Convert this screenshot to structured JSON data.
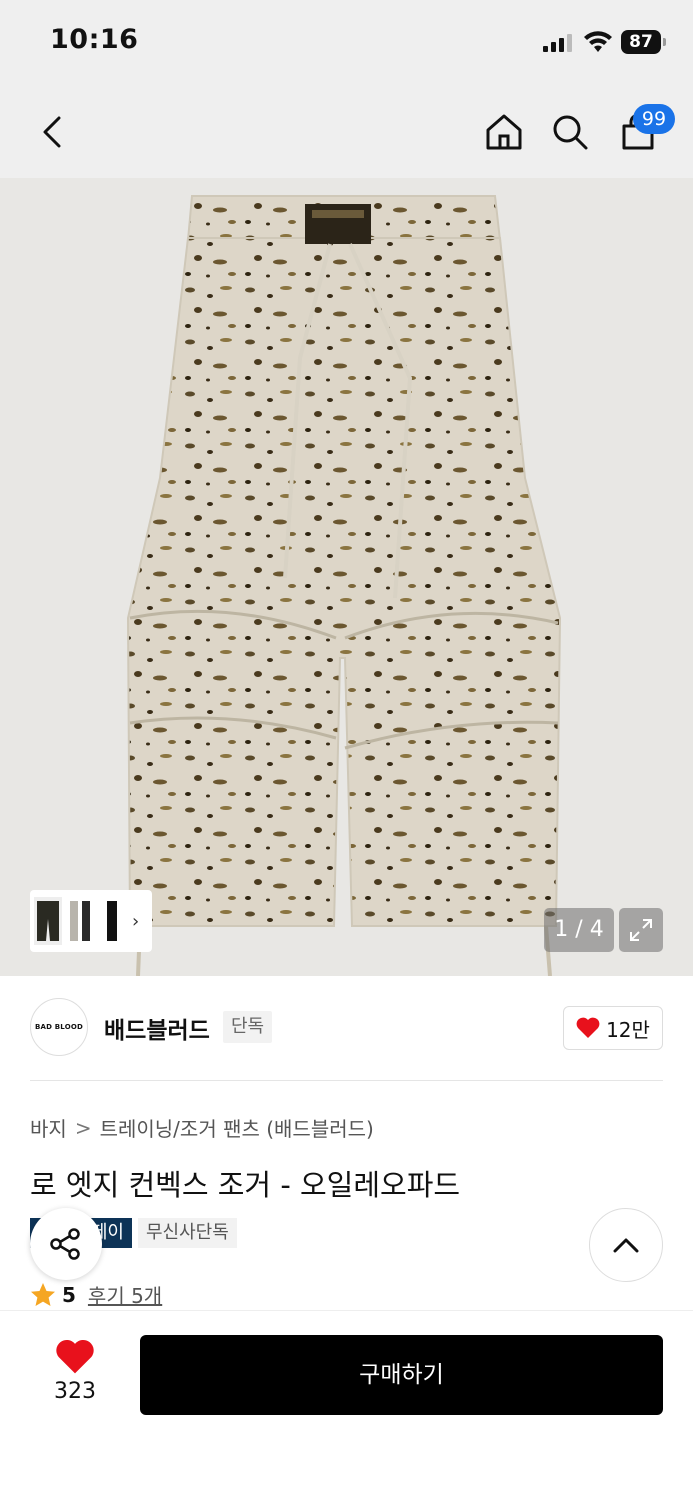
{
  "status_bar": {
    "time": "10:16",
    "battery": "87"
  },
  "nav": {
    "cart_count": "99"
  },
  "gallery": {
    "counter": "1 / 4",
    "thumbnail_count": 3
  },
  "brand": {
    "logo_text": "BAD BLOOD",
    "name": "배드블러드",
    "tag": "단독",
    "likes": "12만"
  },
  "breadcrumb": {
    "category": "바지",
    "separator": ">",
    "subcategory": "트레이닝/조거 팬츠 (배드블러드)"
  },
  "product": {
    "title": "로 엣지 컨벡스 조거 - 오일레오파드",
    "tags": [
      "페이",
      "무신사단독"
    ],
    "rating": "5",
    "reviews": "후기 5개"
  },
  "bottom_bar": {
    "wish_count": "323",
    "buy_label": "구매하기"
  },
  "colors": {
    "accent_blue": "#1a73e8",
    "heart_red": "#e8111c",
    "star_orange": "#f5a623",
    "tag_navy": "#0d3357"
  }
}
